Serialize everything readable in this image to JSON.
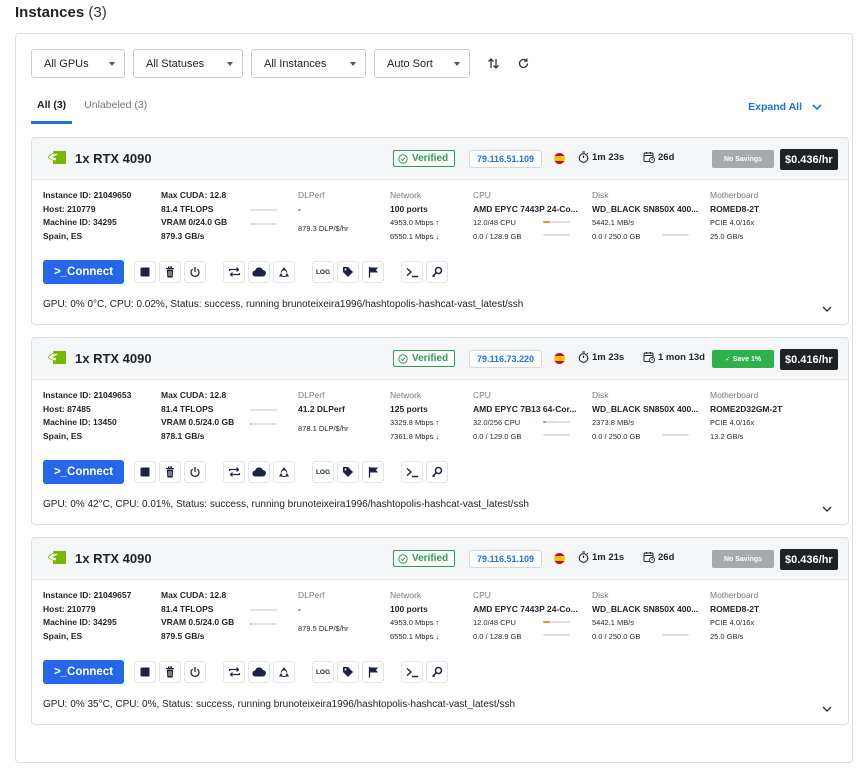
{
  "page": {
    "title": "Instances",
    "count": "(3)"
  },
  "filters": [
    {
      "label": "All GPUs"
    },
    {
      "label": "All Statuses"
    },
    {
      "label": "All Instances"
    },
    {
      "label": "Auto Sort"
    }
  ],
  "tabs": [
    {
      "label": "All (3)",
      "active": true
    },
    {
      "label": "Unlabeled (3)",
      "active": false
    }
  ],
  "expand_label": "Expand All",
  "labels": {
    "dlperf": "DLPerf",
    "network": "Network",
    "cpu": "CPU",
    "disk": "Disk",
    "motherboard": "Motherboard",
    "connect": ">_Connect",
    "log": "LOG"
  },
  "instances": [
    {
      "gpu": "1x RTX 4090",
      "verified": "Verified",
      "ip": "79.116.51.109",
      "uptime": "1m 23s",
      "age": "26d",
      "savings": "No Savings",
      "savings_type": "none",
      "price": "$0.436/hr",
      "instance_id": "Instance ID: 21049650",
      "host": "Host: 210779",
      "machine_id": "Machine ID: 34295",
      "location": "Spain, ES",
      "max_cuda": "Max CUDA: 12.8",
      "tflops": "81.4 TFLOPS",
      "vram": "VRAM 0/24.0 GB",
      "vram_fraction": 0.0,
      "mem_bw": "879.3 GB/s",
      "dlperf": "-",
      "dlperf_per_dollar": "879.3 DLP/$/hr",
      "ports": "100 ports",
      "net_up": "4953.0 Mbps",
      "net_down": "6550.1 Mbps",
      "cpu_name": "AMD EPYC 7443P 24-Co...",
      "cpu_usage": "12.0/48 CPU",
      "cpu_fraction": 0.25,
      "ram": "0.0 / 128.9 GB",
      "ram_fraction": 0.0,
      "disk_name": "WD_BLACK SN850X 400...",
      "disk_speed": "5442.1 MB/s",
      "disk_usage": "0.0 / 250.0 GB",
      "disk_fraction": 0.0,
      "motherboard": "ROMED8-2T",
      "pcie": "PCIE 4.0/16x",
      "pcie_bw": "25.0 GB/s",
      "status": "GPU: 0% 0°C, CPU: 0.02%, Status: success, running brunoteixeira1996/hashtopolis-hashcat-vast_latest/ssh"
    },
    {
      "gpu": "1x RTX 4090",
      "verified": "Verified",
      "ip": "79.116.73.220",
      "uptime": "1m 23s",
      "age": "1 mon 13d",
      "savings": "Save 1%",
      "savings_type": "save",
      "price": "$0.416/hr",
      "instance_id": "Instance ID: 21049653",
      "host": "Host: 87485",
      "machine_id": "Machine ID: 13450",
      "location": "Spain, ES",
      "max_cuda": "Max CUDA: 12.8",
      "tflops": "81.4 TFLOPS",
      "vram": "VRAM 0.5/24.0 GB",
      "vram_fraction": 0.02,
      "mem_bw": "878.1 GB/s",
      "dlperf": "41.2 DLPerf",
      "dlperf_per_dollar": "878.1 DLP/$/hr",
      "ports": "125 ports",
      "net_up": "3329.8 Mbps",
      "net_down": "7361.8 Mbps",
      "cpu_name": "AMD EPYC 7B13 64-Cor...",
      "cpu_usage": "32.0/256 CPU",
      "cpu_fraction": 0.125,
      "ram": "0.0 / 129.0 GB",
      "ram_fraction": 0.0,
      "disk_name": "WD_BLACK SN850X 400...",
      "disk_speed": "2373.8 MB/s",
      "disk_usage": "0.0 / 250.0 GB",
      "disk_fraction": 0.0,
      "motherboard": "ROME2D32GM-2T",
      "pcie": "PCIE 4.0/16x",
      "pcie_bw": "13.2 GB/s",
      "status": "GPU: 0% 42°C, CPU: 0.01%, Status: success, running brunoteixeira1996/hashtopolis-hashcat-vast_latest/ssh"
    },
    {
      "gpu": "1x RTX 4090",
      "verified": "Verified",
      "ip": "79.116.51.109",
      "uptime": "1m 21s",
      "age": "26d",
      "savings": "No Savings",
      "savings_type": "none",
      "price": "$0.436/hr",
      "instance_id": "Instance ID: 21049657",
      "host": "Host: 210779",
      "machine_id": "Machine ID: 34295",
      "location": "Spain, ES",
      "max_cuda": "Max CUDA: 12.8",
      "tflops": "81.4 TFLOPS",
      "vram": "VRAM 0.5/24.0 GB",
      "vram_fraction": 0.02,
      "mem_bw": "879.5 GB/s",
      "dlperf": "-",
      "dlperf_per_dollar": "879.5 DLP/$/hr",
      "ports": "100 ports",
      "net_up": "4953.0 Mbps",
      "net_down": "6550.1 Mbps",
      "cpu_name": "AMD EPYC 7443P 24-Co...",
      "cpu_usage": "12.0/48 CPU",
      "cpu_fraction": 0.25,
      "ram": "0.0 / 128.9 GB",
      "ram_fraction": 0.0,
      "disk_name": "WD_BLACK SN850X 400...",
      "disk_speed": "5442.1 MB/s",
      "disk_usage": "0.0 / 250.0 GB",
      "disk_fraction": 0.0,
      "motherboard": "ROMED8-2T",
      "pcie": "PCIE 4.0/16x",
      "pcie_bw": "25.0 GB/s",
      "status": "GPU: 0% 35°C, CPU: 0%, Status: success, running brunoteixeira1996/hashtopolis-hashcat-vast_latest/ssh"
    }
  ],
  "colors": {
    "accent": "#2666e8",
    "link": "#1a73e8",
    "verified": "#2e9d52",
    "save": "#2eb14a",
    "no_savings": "#a6a9ad",
    "price_bg": "#1e2125",
    "usage_bar": "#f0903a"
  }
}
